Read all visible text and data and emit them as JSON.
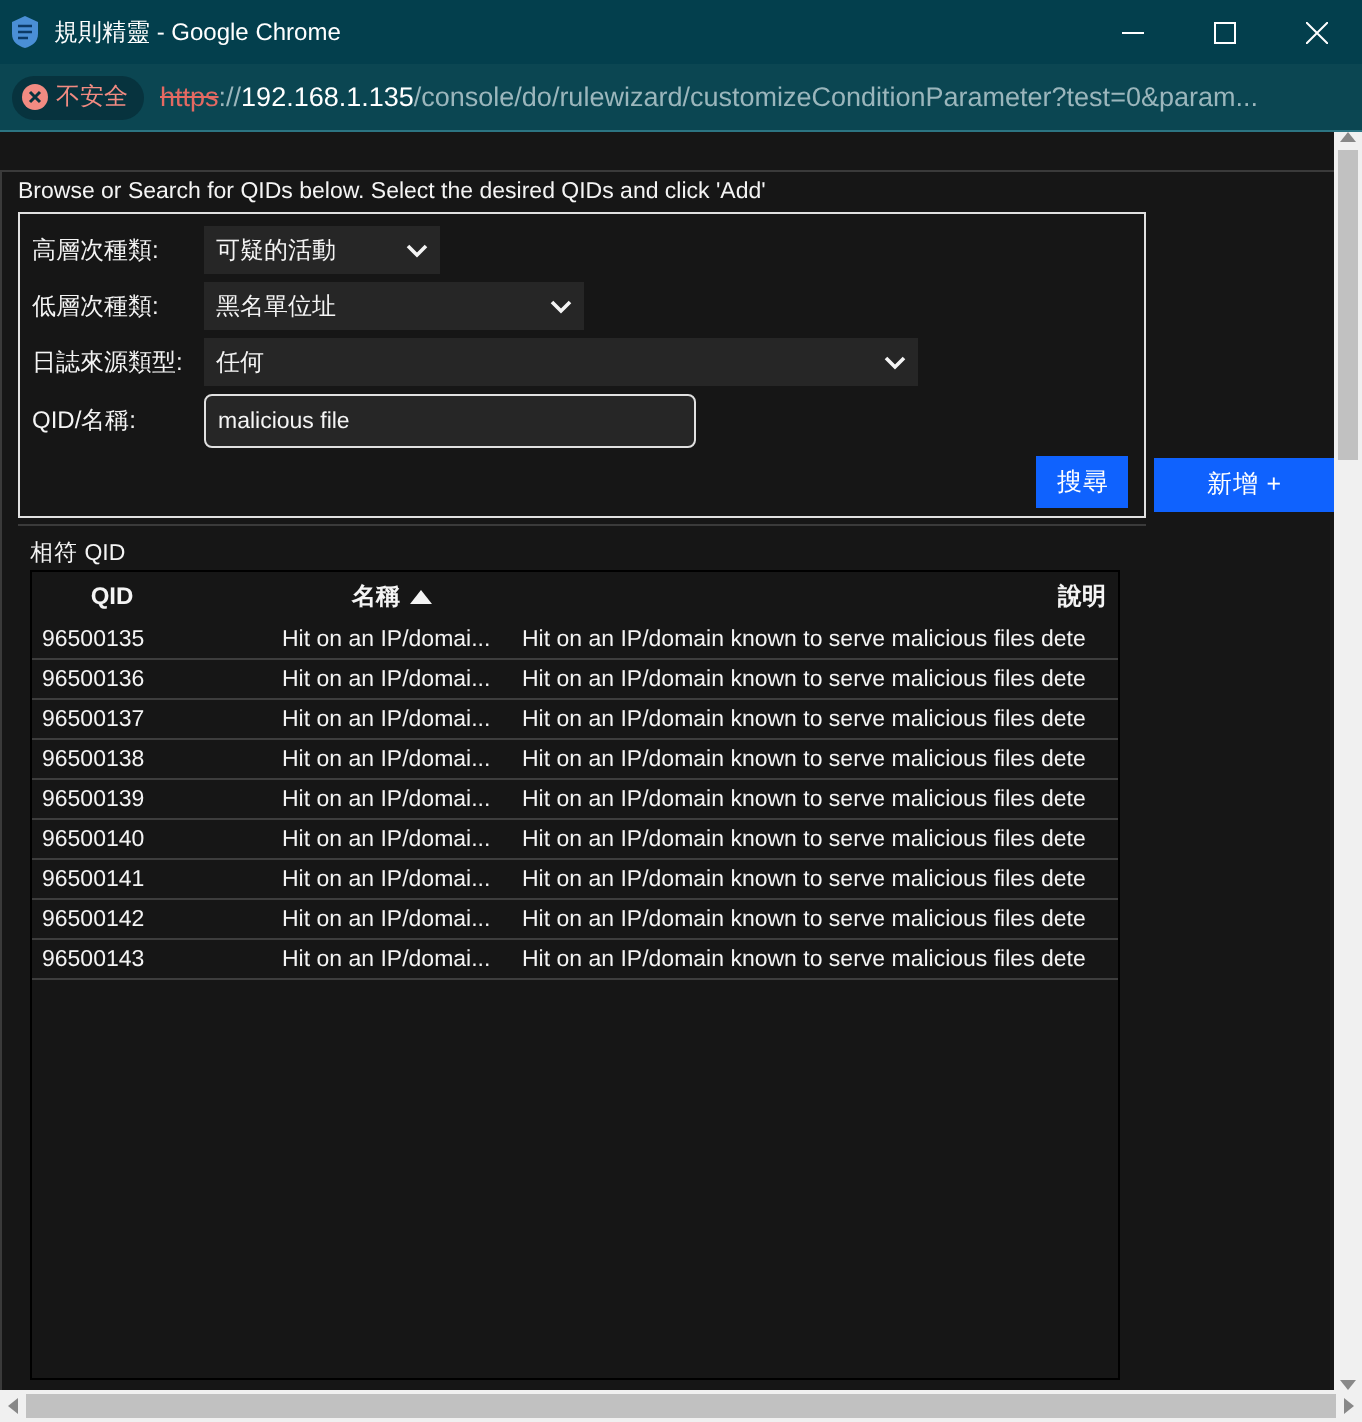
{
  "window": {
    "title": "規則精靈 - Google Chrome"
  },
  "address_bar": {
    "security": "不安全",
    "url_scheme": "https",
    "url_separator": "://",
    "url_host": "192.168.1.135",
    "url_path": "/console/do/rulewizard/customizeConditionParameter?test=0&param..."
  },
  "intro": "Browse or Search for QIDs below. Select the desired QIDs and click 'Add'",
  "filters": [
    {
      "label": "高層次種類:",
      "kind": "select",
      "value": "可疑的活動"
    },
    {
      "label": "低層次種類:",
      "kind": "select",
      "value": "黑名單位址"
    },
    {
      "label": "日誌來源類型:",
      "kind": "select",
      "value": "任何"
    },
    {
      "label": "QID/名稱:",
      "kind": "text",
      "value": "malicious file"
    }
  ],
  "search_button": "搜尋",
  "results": {
    "title": "相符 QID",
    "columns": [
      {
        "label": "QID",
        "sorted": false
      },
      {
        "label": "名稱",
        "sorted": true
      },
      {
        "label": "說明",
        "sorted": false
      }
    ],
    "rows": [
      [
        "96500135",
        "Hit on an IP/domai...",
        "Hit on an IP/domain known to serve malicious files dete"
      ],
      [
        "96500136",
        "Hit on an IP/domai...",
        "Hit on an IP/domain known to serve malicious files dete"
      ],
      [
        "96500137",
        "Hit on an IP/domai...",
        "Hit on an IP/domain known to serve malicious files dete"
      ],
      [
        "96500138",
        "Hit on an IP/domai...",
        "Hit on an IP/domain known to serve malicious files dete"
      ],
      [
        "96500139",
        "Hit on an IP/domai...",
        "Hit on an IP/domain known to serve malicious files dete"
      ],
      [
        "96500140",
        "Hit on an IP/domai...",
        "Hit on an IP/domain known to serve malicious files dete"
      ],
      [
        "96500141",
        "Hit on an IP/domai...",
        "Hit on an IP/domain known to serve malicious files dete"
      ],
      [
        "96500142",
        "Hit on an IP/domai...",
        "Hit on an IP/domain known to serve malicious files dete"
      ],
      [
        "96500143",
        "Hit on an IP/domai...",
        "Hit on an IP/domain known to serve malicious files dete"
      ]
    ]
  },
  "add_button": "新增 +"
}
